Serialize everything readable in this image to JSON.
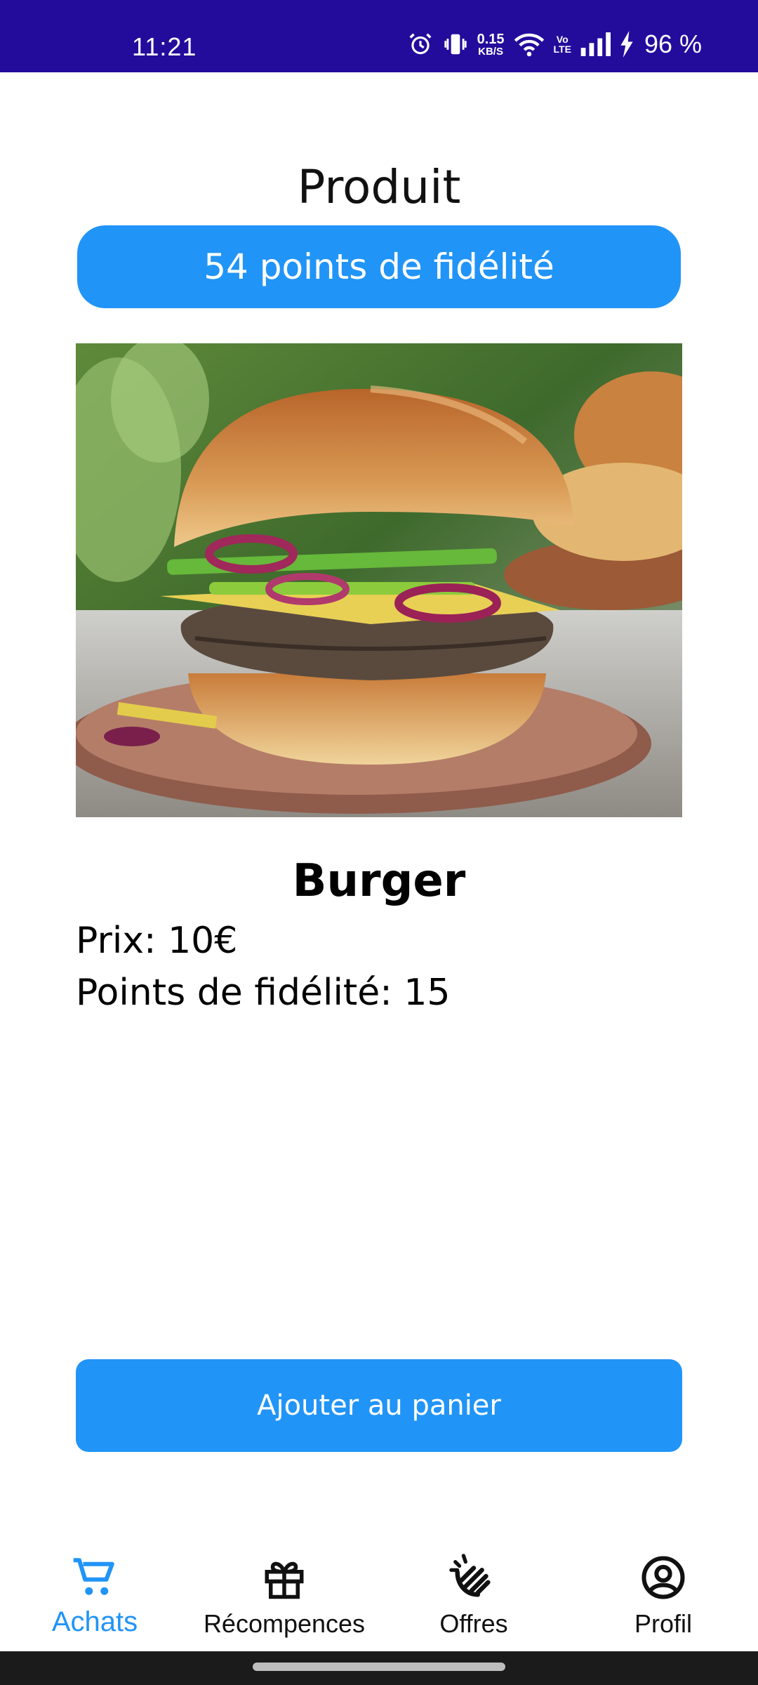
{
  "status_bar": {
    "time": "11:21",
    "net_speed_value": "0.15",
    "net_speed_unit": "KB/S",
    "volte_top": "Vo",
    "volte_bottom": "LTE",
    "battery": "96 %",
    "icons": [
      "alarm-icon",
      "vibrate-icon",
      "wifi-icon",
      "signal-icon",
      "charging-icon"
    ]
  },
  "header": {
    "title": "Produit",
    "points_badge": "54 points de fidélité"
  },
  "product": {
    "image": "burger-photo",
    "name": "Burger",
    "price_line": "Prix: 10€",
    "loyalty_line": "Points de fidélité: 15"
  },
  "actions": {
    "add_to_cart": "Ajouter au panier"
  },
  "bottom_nav": {
    "items": [
      {
        "label": "Achats",
        "icon": "cart-icon",
        "active": true
      },
      {
        "label": "Récompences",
        "icon": "gift-icon",
        "active": false
      },
      {
        "label": "Offres",
        "icon": "offers-hand-icon",
        "active": false
      },
      {
        "label": "Profil",
        "icon": "profile-icon",
        "active": false
      }
    ]
  },
  "colors": {
    "status_bar": "#230c9c",
    "accent": "#2194f7",
    "text": "#000000",
    "background": "#ffffff"
  }
}
